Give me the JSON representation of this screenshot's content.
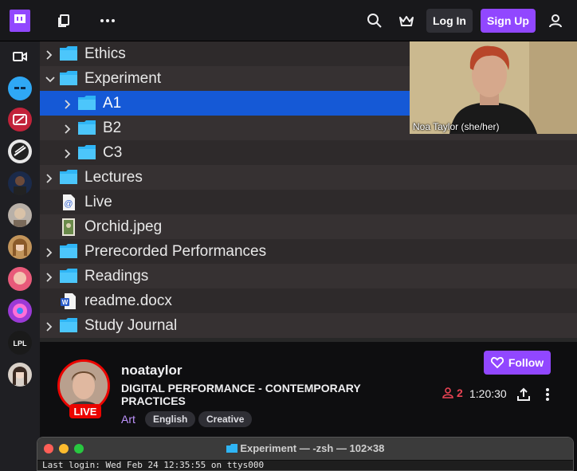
{
  "topbar": {
    "login_label": "Log In",
    "signup_label": "Sign Up"
  },
  "finder": {
    "rows": [
      {
        "name": "Ethics"
      },
      {
        "name": "Experiment"
      },
      {
        "name": "A1"
      },
      {
        "name": "B2"
      },
      {
        "name": "C3"
      },
      {
        "name": "Lectures"
      },
      {
        "name": "Live"
      },
      {
        "name": "Orchid.jpeg"
      },
      {
        "name": "Prerecorded Performances"
      },
      {
        "name": "Readings"
      },
      {
        "name": "readme.docx"
      },
      {
        "name": "Study Journal"
      }
    ]
  },
  "webcam": {
    "label": "Noa Taylor (she/her)"
  },
  "stream": {
    "channel": "noataylor",
    "title": "DIGITAL PERFORMANCE - CONTEMPORARY PRACTICES",
    "category": "Art",
    "tags": [
      "English",
      "Creative"
    ],
    "live_label": "LIVE",
    "follow_label": "Follow",
    "viewers": "2",
    "uptime": "1:20:30"
  },
  "terminal": {
    "title": "Experiment — -zsh — 102×38",
    "line": "Last login: Wed Feb 24 12:35:55 on ttys000"
  },
  "colors": {
    "brand": "#9147ff",
    "live": "#eb0400",
    "selection": "#1559d6",
    "folder": "#2fb5f5"
  }
}
